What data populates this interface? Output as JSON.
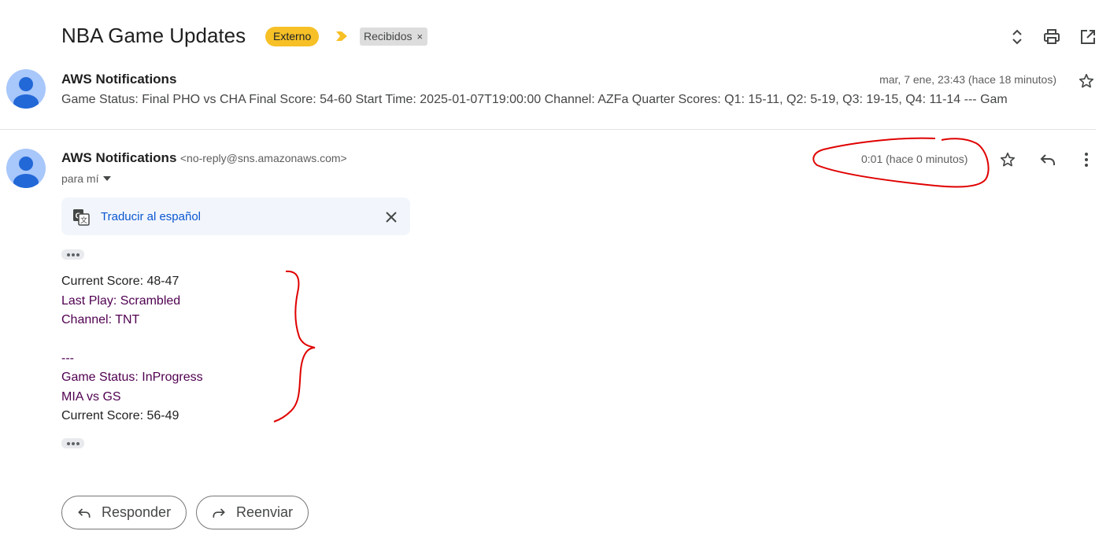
{
  "header": {
    "subject": "NBA Game Updates",
    "badge_externo": "Externo",
    "chip_recibidos": "Recibidos",
    "chip_remove": "×"
  },
  "message1": {
    "sender": "AWS Notifications",
    "date": "mar, 7 ene, 23:43 (hace 18 minutos)",
    "snippet": "Game Status: Final PHO vs CHA Final Score: 54-60 Start Time: 2025-01-07T19:00:00 Channel: AZFa Quarter Scores: Q1: 15-11, Q2: 5-19, Q3: 19-15, Q4: 11-14 --- Gam"
  },
  "message2": {
    "sender": "AWS Notifications",
    "email": "<no-reply@sns.amazonaws.com>",
    "date": "0:01 (hace 0 minutos)",
    "recipient": "para mí",
    "translate_label": "Traducir al español",
    "body": [
      "Current Score: 48-47",
      "Last Play: Scrambled",
      "Channel: TNT",
      "",
      "---",
      "Game Status: InProgress",
      "MIA vs GS",
      "Current Score: 56-49"
    ]
  },
  "actions": {
    "reply": "Responder",
    "forward": "Reenviar"
  },
  "icons": [
    "expand-collapse-icon",
    "print-icon",
    "open-in-new-window-icon",
    "star-icon",
    "reply-icon",
    "more-vert-icon",
    "translate-icon",
    "close-icon",
    "label-arrow-icon",
    "avatar-icon"
  ],
  "colors": {
    "externo_badge": "#f6c026",
    "label_arrow": "#f6c026",
    "link": "#0b57d0",
    "annotation_red": "#e00000",
    "quoted_text": "#500050"
  }
}
